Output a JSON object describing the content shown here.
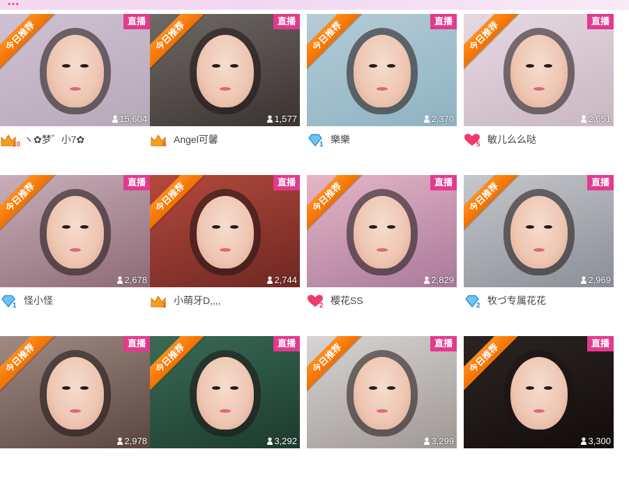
{
  "header": {
    "title_fragment": "…"
  },
  "labels": {
    "live": "直播",
    "recommend": "今日推荐"
  },
  "rows": [
    {
      "cards": [
        {
          "name": "ヽ✿梦゛小7✿",
          "viewers": "15,604",
          "level_type": "crown",
          "level": "10",
          "recommended": true,
          "palette": [
            "#cfc1d3",
            "#b7a8b9"
          ]
        },
        {
          "name": "Angel可馨",
          "viewers": "1,577",
          "level_type": "crown",
          "level": "8",
          "recommended": true,
          "palette": [
            "#6e6a66",
            "#3c3230"
          ]
        },
        {
          "name": "樂樂",
          "viewers": "2,370",
          "level_type": "diamond",
          "level": "1",
          "recommended": true,
          "palette": [
            "#b4ccd6",
            "#8eb3c2"
          ]
        },
        {
          "name": "敏儿么么哒",
          "viewers": "2,651",
          "level_type": "heart",
          "level": "5",
          "recommended": true,
          "palette": [
            "#e6d8e2",
            "#c9b7c2"
          ]
        }
      ]
    },
    {
      "cards": [
        {
          "name": "怪小怪",
          "viewers": "2,678",
          "level_type": "diamond",
          "level": "1",
          "recommended": true,
          "palette": [
            "#c9aeb9",
            "#8c6a76"
          ]
        },
        {
          "name": "小萌牙D,,,,",
          "viewers": "2,744",
          "level_type": "crown",
          "level": "2",
          "recommended": true,
          "palette": [
            "#b44a3c",
            "#6e2722"
          ]
        },
        {
          "name": "樱花SS",
          "viewers": "2,829",
          "level_type": "heart",
          "level": "2",
          "recommended": true,
          "palette": [
            "#e6b6c6",
            "#a8799b"
          ]
        },
        {
          "name": "牧づ专属花花",
          "viewers": "2,969",
          "level_type": "diamond",
          "level": "2",
          "recommended": true,
          "palette": [
            "#c6c7cc",
            "#8a8e96"
          ]
        }
      ]
    },
    {
      "cards": [
        {
          "name": "",
          "viewers": "2,978",
          "level_type": "none",
          "level": "",
          "recommended": true,
          "palette": [
            "#a08b84",
            "#5a4540"
          ]
        },
        {
          "name": "",
          "viewers": "3,292",
          "level_type": "none",
          "level": "",
          "recommended": true,
          "palette": [
            "#3a6b56",
            "#1c3a2d"
          ]
        },
        {
          "name": "",
          "viewers": "3,299",
          "level_type": "none",
          "level": "",
          "recommended": true,
          "palette": [
            "#d8d4d3",
            "#9e9894"
          ]
        },
        {
          "name": "",
          "viewers": "3,300",
          "level_type": "none",
          "level": "",
          "recommended": true,
          "palette": [
            "#2b2423",
            "#120d0c"
          ]
        }
      ]
    }
  ]
}
